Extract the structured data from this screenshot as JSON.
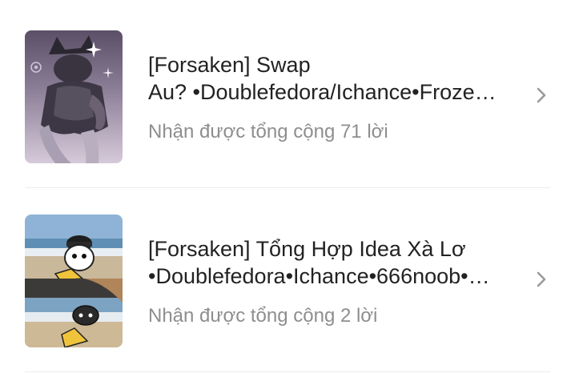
{
  "stories": [
    {
      "title_line1": "[Forsaken] Swap",
      "title_line2": "Au? •Doublefedora/Ichance•Frozen•…",
      "replies": "Nhận được tổng cộng 71 lời",
      "thumbnail_icon": "dark-character-artwork-thumbnail"
    },
    {
      "title_line1": "[Forsaken] Tổng Hợp Idea Xà Lơ",
      "title_line2": "•Doublefedora•Ichance•666noob•…",
      "replies": "Nhận được tổng cộng 2 lời",
      "thumbnail_icon": "beach-characters-thumbnail"
    }
  ],
  "icons": {
    "chevron": "chevron-right-icon"
  },
  "colors": {
    "title": "#222222",
    "meta": "#8e8e8e",
    "chevron": "#9a9a9a",
    "divider": "#ececec"
  }
}
